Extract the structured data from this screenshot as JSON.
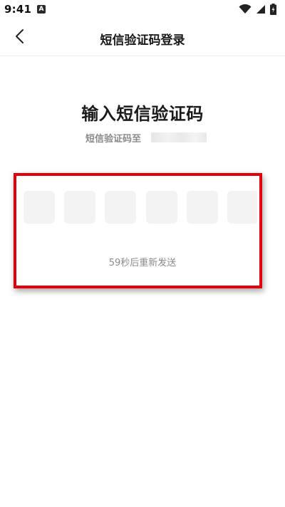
{
  "status_bar": {
    "time": "9:41",
    "notification_icon": "a-notification-icon",
    "icons": [
      "wifi-icon",
      "signal-icon",
      "battery-icon"
    ]
  },
  "header": {
    "back_icon": "chevron-left-icon",
    "title": "短信验证码登录"
  },
  "main": {
    "title": "输入短信验证码",
    "subtitle": "短信验证码至",
    "phone": "",
    "code_cells": [
      "",
      "",
      "",
      "",
      "",
      ""
    ],
    "resend_text": "59秒后重新发送"
  },
  "colors": {
    "highlight": "#e3000b",
    "cell_bg": "#f3f3f3",
    "muted_text": "#8a8a8a"
  }
}
